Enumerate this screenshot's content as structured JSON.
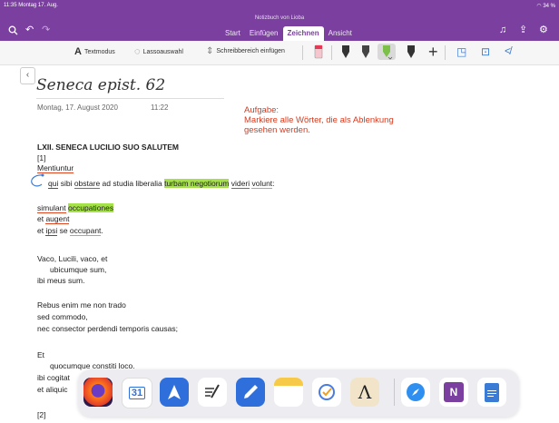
{
  "status": {
    "time_date": "11:35  Montag 17. Aug.",
    "battery": "34 %"
  },
  "notebook_title": "Notizbuch von Lioba",
  "tabs": [
    {
      "label": "Start"
    },
    {
      "label": "Einfügen"
    },
    {
      "label": "Zeichnen",
      "active": true
    },
    {
      "label": "Ansicht"
    }
  ],
  "ribbon": {
    "textmode": "Textmodus",
    "lasso": "Lassoauswahl",
    "insert_space": "Schreibbereich einfügen"
  },
  "page": {
    "title": "Seneca epist. 62",
    "date": "Montag, 17. August 2020",
    "time": "11:22"
  },
  "task": {
    "line1": "Aufgabe:",
    "line2": "Markiere alle Wörter, die als Ablenkung",
    "line3": "gesehen werden."
  },
  "text": {
    "heading": "LXII. SENECA LUCILIO SUO SALUTEM",
    "l1": "[1]",
    "l2": "Mentiuntur",
    "l3a": "qui",
    "l3b": " sibi ",
    "l3c": "obstare",
    "l3d": " ad studia liberalia ",
    "l3e": "turbam negotiorum",
    "l3f": " ",
    "l3g": "videri",
    "l3h": " ",
    "l3i": "volunt",
    "l3j": ":",
    "l4a": "simulant",
    "l4b": " ",
    "l4c": "occupationes",
    "l5a": "et ",
    "l5b": "augent",
    "l6a": "et ",
    "l6b": "ipsi",
    "l6c": " se ",
    "l6d": "occupant",
    "l6e": ".",
    "l7": "Vaco, Lucili, vaco, et",
    "l8": "ubicumque sum,",
    "l9": "ibi meus sum.",
    "l10": "Rebus enim me non trado",
    "l11": "sed commodo,",
    "l12": "nec consector perdendi temporis causas;",
    "l13": "Et",
    "l14": "quocumque constiti loco.",
    "l15": "ibi cogitat",
    "l16": "et aliquic",
    "l17": "[2]"
  },
  "dock": {
    "calendar_day": "31",
    "apps": [
      "firefox-app",
      "calendar-app",
      "spark-app",
      "notes-pen-app",
      "goodnotes-app",
      "notes-app",
      "tasks-app",
      "lambda-app",
      "safari-app",
      "onenote-app",
      "docs-app"
    ]
  },
  "colors": {
    "accent": "#7b3fa0",
    "task": "#d63a1e",
    "highlight": "#a5e24a"
  }
}
